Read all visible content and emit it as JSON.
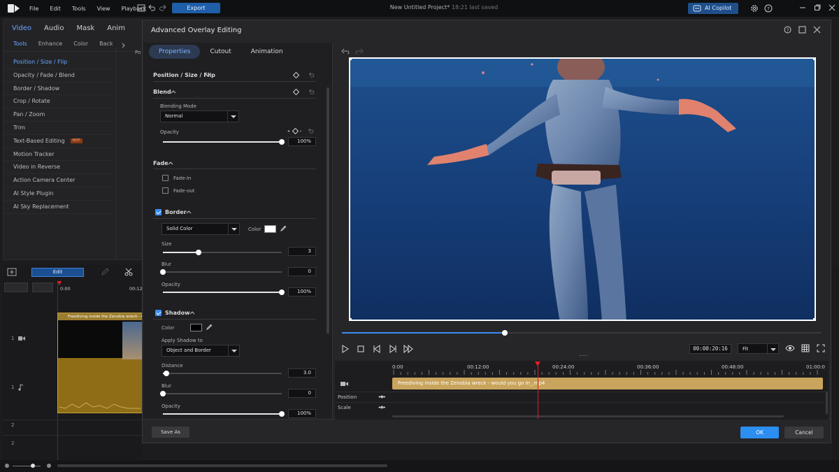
{
  "app": {
    "menu": [
      "File",
      "Edit",
      "Tools",
      "View",
      "Playback"
    ],
    "export_label": "Export",
    "project_title": "New Untitled Project*",
    "project_saved": "18:21 last saved",
    "copilot_label": "AI Copilot"
  },
  "left_panel": {
    "tabs": [
      "Video",
      "Audio",
      "Mask",
      "Anim"
    ],
    "subtabs": [
      "Tools",
      "Enhance",
      "Color",
      "Back"
    ],
    "partial_label": "Po",
    "items": [
      "Position / Size / Flip",
      "Opacity / Fade / Blend",
      "Border / Shadow",
      "Crop / Rotate",
      "Pan / Zoom",
      "Trim",
      "Text-Based Editing",
      "Motion Tracker",
      "Video in Reverse",
      "Action Camera Center",
      "AI Style Plugin",
      "AI Sky Replacement"
    ],
    "hot_badge": "HOT"
  },
  "back_timeline": {
    "edit_label": "Edit",
    "time_start": "0:00",
    "time_partial": "00:12",
    "clip_title": "Freediving inside the Zenobia wreck - would you go in_.mp4",
    "track_numbers": [
      "1",
      "1",
      "2",
      "2"
    ]
  },
  "dialog": {
    "title": "Advanced Overlay Editing",
    "tabs": [
      "Properties",
      "Cutout",
      "Animation"
    ],
    "sections": {
      "position": "Position / Size / Flip",
      "blend": "Blend",
      "fade": "Fade",
      "border": "Border",
      "shadow": "Shadow"
    },
    "blend": {
      "mode_label": "Blending Mode",
      "mode_value": "Normal",
      "opacity_label": "Opacity",
      "opacity_value": "100%",
      "opacity_level": 100
    },
    "fade": {
      "fade_in": "Fade-in",
      "fade_out": "Fade-out",
      "fade_in_checked": false,
      "fade_out_checked": false
    },
    "border": {
      "enabled": true,
      "type_value": "Solid Color",
      "color_label": "Color",
      "color_value": "#ffffff",
      "size_label": "Size",
      "size_value": "3",
      "size_level": 30,
      "blur_label": "Blur",
      "blur_value": "0",
      "blur_level": 0,
      "opacity_label": "Opacity",
      "opacity_value": "100%",
      "opacity_level": 100
    },
    "shadow": {
      "enabled": true,
      "color_label": "Color",
      "color_value": "#000000",
      "apply_label": "Apply Shadow to",
      "apply_value": "Object and Border",
      "distance_label": "Distance",
      "distance_value": "3.0",
      "distance_level": 3,
      "blur_label": "Blur",
      "blur_value": "0",
      "blur_level": 0,
      "opacity_label": "Opacity",
      "opacity_value": "100%",
      "opacity_level": 100
    },
    "save_as_label": "Save As",
    "ok_label": "OK",
    "cancel_label": "Cancel",
    "playback": {
      "timecode": "00:00:20:16",
      "zoom_value": "Fit",
      "progress": 34
    },
    "timeline": {
      "ticks": [
        "0:00",
        "00:12:00",
        "00:24:00",
        "00:36:00",
        "00:48:00",
        "01:00:0"
      ],
      "clip_title": "Freediving inside the Zenobia wreck - would you go in_.mp4",
      "rows": [
        "Position",
        "Scale"
      ]
    }
  },
  "colors": {
    "accent": "#3b8ef0",
    "clip": "#c9a45c",
    "playhead": "#e02020"
  }
}
